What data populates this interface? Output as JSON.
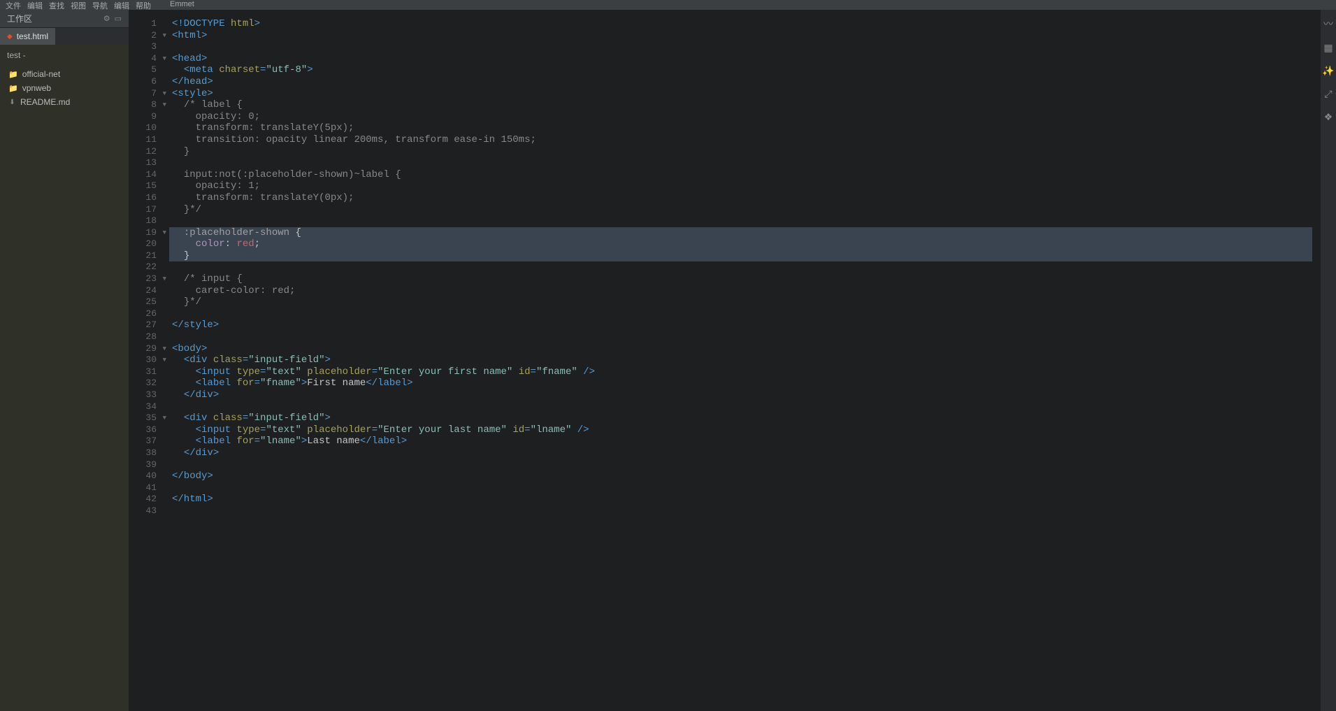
{
  "menubar": [
    "文件",
    "编辑",
    "查找",
    "视图",
    "导航",
    "编辑",
    "帮助",
    "",
    "",
    "Emmet"
  ],
  "sidebar": {
    "title": "工作区",
    "tab": "test.html",
    "crumb": "test -",
    "items": [
      {
        "type": "folder",
        "label": "official-net"
      },
      {
        "type": "folder",
        "label": "vpnweb"
      },
      {
        "type": "file",
        "label": "README.md"
      }
    ]
  },
  "editor": {
    "lines": [
      {
        "n": 1,
        "fold": "",
        "seg": [
          [
            "c-tag",
            "<!DOCTYPE "
          ],
          [
            "c-attr",
            "html"
          ],
          [
            "c-tag",
            ">"
          ]
        ]
      },
      {
        "n": 2,
        "fold": "▼",
        "seg": [
          [
            "c-tag",
            "<html>"
          ]
        ]
      },
      {
        "n": 3,
        "fold": "",
        "seg": [
          [
            "",
            ""
          ]
        ]
      },
      {
        "n": 4,
        "fold": "▼",
        "seg": [
          [
            "c-tag",
            "<head>"
          ]
        ]
      },
      {
        "n": 5,
        "fold": "",
        "seg": [
          [
            "",
            "  "
          ],
          [
            "c-tag",
            "<meta "
          ],
          [
            "c-attr",
            "charset"
          ],
          [
            "c-tag",
            "="
          ],
          [
            "c-str",
            "\"utf-8\""
          ],
          [
            "c-tag",
            ">"
          ]
        ]
      },
      {
        "n": 6,
        "fold": "",
        "seg": [
          [
            "c-tag",
            "</head>"
          ]
        ]
      },
      {
        "n": 7,
        "fold": "▼",
        "seg": [
          [
            "c-tag",
            "<style>"
          ]
        ]
      },
      {
        "n": 8,
        "fold": "▼",
        "seg": [
          [
            "",
            "  "
          ],
          [
            "c-comment",
            "/* label {"
          ]
        ]
      },
      {
        "n": 9,
        "fold": "",
        "seg": [
          [
            "",
            "    "
          ],
          [
            "c-comment",
            "opacity: 0;"
          ]
        ]
      },
      {
        "n": 10,
        "fold": "",
        "seg": [
          [
            "",
            "    "
          ],
          [
            "c-comment",
            "transform: translateY(5px);"
          ]
        ]
      },
      {
        "n": 11,
        "fold": "",
        "seg": [
          [
            "",
            "    "
          ],
          [
            "c-comment",
            "transition: opacity linear 200ms, transform ease-in 150ms;"
          ]
        ]
      },
      {
        "n": 12,
        "fold": "",
        "seg": [
          [
            "",
            "  "
          ],
          [
            "c-comment",
            "}"
          ]
        ]
      },
      {
        "n": 13,
        "fold": "",
        "seg": [
          [
            "",
            ""
          ]
        ]
      },
      {
        "n": 14,
        "fold": "",
        "seg": [
          [
            "",
            "  "
          ],
          [
            "c-comment",
            "input:not(:placeholder-shown)~label {"
          ]
        ]
      },
      {
        "n": 15,
        "fold": "",
        "seg": [
          [
            "",
            "    "
          ],
          [
            "c-comment",
            "opacity: 1;"
          ]
        ]
      },
      {
        "n": 16,
        "fold": "",
        "seg": [
          [
            "",
            "    "
          ],
          [
            "c-comment",
            "transform: translateY(0px);"
          ]
        ]
      },
      {
        "n": 17,
        "fold": "",
        "seg": [
          [
            "",
            "  "
          ],
          [
            "c-comment",
            "}*/"
          ]
        ]
      },
      {
        "n": 18,
        "fold": "",
        "seg": [
          [
            "",
            ""
          ]
        ]
      },
      {
        "n": 19,
        "fold": "▼",
        "hl": true,
        "seg": [
          [
            "",
            "  "
          ],
          [
            "c-sel",
            ":placeholder-shown "
          ],
          [
            "c-text",
            "{"
          ]
        ]
      },
      {
        "n": 20,
        "fold": "",
        "hl": true,
        "seg": [
          [
            "",
            "    "
          ],
          [
            "c-prop",
            "color"
          ],
          [
            "c-text",
            ": "
          ],
          [
            "c-val",
            "red"
          ],
          [
            "c-text",
            ";"
          ]
        ]
      },
      {
        "n": 21,
        "fold": "",
        "hl": true,
        "seg": [
          [
            "",
            "  "
          ],
          [
            "c-text",
            "}"
          ]
        ]
      },
      {
        "n": 22,
        "fold": "",
        "seg": [
          [
            "",
            ""
          ]
        ]
      },
      {
        "n": 23,
        "fold": "▼",
        "seg": [
          [
            "",
            "  "
          ],
          [
            "c-comment",
            "/* input {"
          ]
        ]
      },
      {
        "n": 24,
        "fold": "",
        "seg": [
          [
            "",
            "    "
          ],
          [
            "c-comment",
            "caret-color: red;"
          ]
        ]
      },
      {
        "n": 25,
        "fold": "",
        "seg": [
          [
            "",
            "  "
          ],
          [
            "c-comment",
            "}*/"
          ]
        ]
      },
      {
        "n": 26,
        "fold": "",
        "seg": [
          [
            "",
            ""
          ]
        ]
      },
      {
        "n": 27,
        "fold": "",
        "seg": [
          [
            "c-tag",
            "</style>"
          ]
        ]
      },
      {
        "n": 28,
        "fold": "",
        "seg": [
          [
            "",
            ""
          ]
        ]
      },
      {
        "n": 29,
        "fold": "▼",
        "seg": [
          [
            "c-tag",
            "<body>"
          ]
        ]
      },
      {
        "n": 30,
        "fold": "▼",
        "seg": [
          [
            "",
            "  "
          ],
          [
            "c-tag",
            "<div "
          ],
          [
            "c-attr",
            "class"
          ],
          [
            "c-tag",
            "="
          ],
          [
            "c-str",
            "\"input-field\""
          ],
          [
            "c-tag",
            ">"
          ]
        ]
      },
      {
        "n": 31,
        "fold": "",
        "seg": [
          [
            "",
            "    "
          ],
          [
            "c-tag",
            "<input "
          ],
          [
            "c-attr",
            "type"
          ],
          [
            "c-tag",
            "="
          ],
          [
            "c-str",
            "\"text\""
          ],
          [
            "c-tag",
            " "
          ],
          [
            "c-attr",
            "placeholder"
          ],
          [
            "c-tag",
            "="
          ],
          [
            "c-str",
            "\"Enter your first name\""
          ],
          [
            "c-tag",
            " "
          ],
          [
            "c-attr",
            "id"
          ],
          [
            "c-tag",
            "="
          ],
          [
            "c-str",
            "\"fname\""
          ],
          [
            "c-tag",
            " />"
          ]
        ]
      },
      {
        "n": 32,
        "fold": "",
        "seg": [
          [
            "",
            "    "
          ],
          [
            "c-tag",
            "<label "
          ],
          [
            "c-attr",
            "for"
          ],
          [
            "c-tag",
            "="
          ],
          [
            "c-str",
            "\"fname\""
          ],
          [
            "c-tag",
            ">"
          ],
          [
            "c-text",
            "First name"
          ],
          [
            "c-tag",
            "</label>"
          ]
        ]
      },
      {
        "n": 33,
        "fold": "",
        "seg": [
          [
            "",
            "  "
          ],
          [
            "c-tag",
            "</div>"
          ]
        ]
      },
      {
        "n": 34,
        "fold": "",
        "seg": [
          [
            "",
            ""
          ]
        ]
      },
      {
        "n": 35,
        "fold": "▼",
        "seg": [
          [
            "",
            "  "
          ],
          [
            "c-tag",
            "<div "
          ],
          [
            "c-attr",
            "class"
          ],
          [
            "c-tag",
            "="
          ],
          [
            "c-str",
            "\"input-field\""
          ],
          [
            "c-tag",
            ">"
          ]
        ]
      },
      {
        "n": 36,
        "fold": "",
        "seg": [
          [
            "",
            "    "
          ],
          [
            "c-tag",
            "<input "
          ],
          [
            "c-attr",
            "type"
          ],
          [
            "c-tag",
            "="
          ],
          [
            "c-str",
            "\"text\""
          ],
          [
            "c-tag",
            " "
          ],
          [
            "c-attr",
            "placeholder"
          ],
          [
            "c-tag",
            "="
          ],
          [
            "c-str",
            "\"Enter your last name\""
          ],
          [
            "c-tag",
            " "
          ],
          [
            "c-attr",
            "id"
          ],
          [
            "c-tag",
            "="
          ],
          [
            "c-str",
            "\"lname\""
          ],
          [
            "c-tag",
            " />"
          ]
        ]
      },
      {
        "n": 37,
        "fold": "",
        "seg": [
          [
            "",
            "    "
          ],
          [
            "c-tag",
            "<label "
          ],
          [
            "c-attr",
            "for"
          ],
          [
            "c-tag",
            "="
          ],
          [
            "c-str",
            "\"lname\""
          ],
          [
            "c-tag",
            ">"
          ],
          [
            "c-text",
            "Last name"
          ],
          [
            "c-tag",
            "</label>"
          ]
        ]
      },
      {
        "n": 38,
        "fold": "",
        "seg": [
          [
            "",
            "  "
          ],
          [
            "c-tag",
            "</div>"
          ]
        ]
      },
      {
        "n": 39,
        "fold": "",
        "seg": [
          [
            "",
            ""
          ]
        ]
      },
      {
        "n": 40,
        "fold": "",
        "seg": [
          [
            "c-tag",
            "</body>"
          ]
        ]
      },
      {
        "n": 41,
        "fold": "",
        "seg": [
          [
            "",
            ""
          ]
        ]
      },
      {
        "n": 42,
        "fold": "",
        "seg": [
          [
            "c-tag",
            "</html>"
          ]
        ]
      },
      {
        "n": 43,
        "fold": "",
        "seg": [
          [
            "",
            ""
          ]
        ]
      }
    ]
  },
  "rail": [
    "〰",
    "▦",
    "✨",
    "⤢",
    "❖"
  ]
}
